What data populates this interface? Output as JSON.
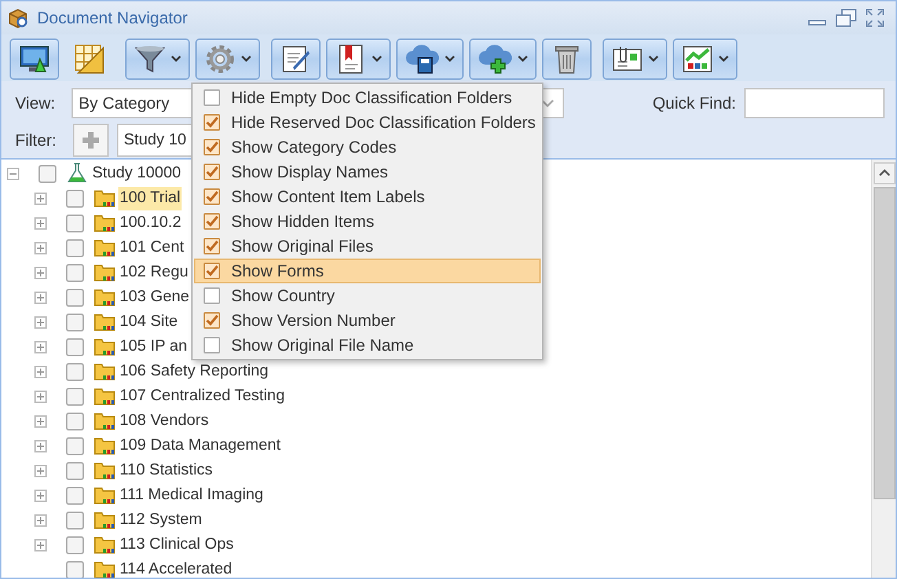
{
  "window": {
    "title": "Document Navigator"
  },
  "toolbar": {
    "groups": [
      {
        "buttons": [
          {
            "dropdown": false,
            "framed": true
          },
          {
            "dropdown": false,
            "framed": false
          }
        ]
      },
      {
        "buttons": [
          {
            "dropdown": true,
            "framed": true
          },
          {
            "dropdown": true,
            "framed": true
          }
        ]
      },
      {
        "buttons": [
          {
            "dropdown": false,
            "framed": true
          },
          {
            "dropdown": true,
            "framed": true
          },
          {
            "dropdown": true,
            "framed": true
          },
          {
            "dropdown": true,
            "framed": true
          },
          {
            "dropdown": false,
            "framed": true
          }
        ]
      },
      {
        "buttons": [
          {
            "dropdown": true,
            "framed": true
          },
          {
            "dropdown": true,
            "framed": true
          }
        ]
      }
    ]
  },
  "view": {
    "label": "View:",
    "value": "By Category"
  },
  "quick_find": {
    "label": "Quick Find:"
  },
  "filter": {
    "label": "Filter:",
    "value": "Study 10"
  },
  "menu": {
    "items": [
      {
        "label": "Hide Empty Doc Classification Folders",
        "checked": false,
        "selected": false
      },
      {
        "label": "Hide Reserved Doc Classification Folders",
        "checked": true,
        "selected": false
      },
      {
        "label": "Show Category Codes",
        "checked": true,
        "selected": false
      },
      {
        "label": "Show Display Names",
        "checked": true,
        "selected": false
      },
      {
        "label": "Show Content Item Labels",
        "checked": true,
        "selected": false
      },
      {
        "label": "Show Hidden Items",
        "checked": true,
        "selected": false
      },
      {
        "label": "Show Original Files",
        "checked": true,
        "selected": false
      },
      {
        "label": "Show Forms",
        "checked": true,
        "selected": true
      },
      {
        "label": "Show Country",
        "checked": false,
        "selected": false
      },
      {
        "label": "Show Version Number",
        "checked": true,
        "selected": false
      },
      {
        "label": "Show Original File Name",
        "checked": false,
        "selected": false
      }
    ]
  },
  "tree": [
    {
      "label": "Study 10000",
      "kind": "study",
      "expanded": true,
      "checked": false,
      "selected": false,
      "children": [
        {
          "label": "100 Trial",
          "kind": "folder",
          "expanded": false,
          "checked": false,
          "selected": true
        },
        {
          "label": "100.10.2",
          "kind": "folder",
          "expanded": false,
          "checked": false,
          "selected": false
        },
        {
          "label": "101 Cent",
          "kind": "folder",
          "expanded": false,
          "checked": false,
          "selected": false
        },
        {
          "label": "102 Regu",
          "kind": "folder",
          "expanded": false,
          "checked": false,
          "selected": false
        },
        {
          "label": "103 Gene",
          "kind": "folder",
          "expanded": false,
          "checked": false,
          "selected": false
        },
        {
          "label": "104 Site",
          "kind": "folder",
          "expanded": false,
          "checked": false,
          "selected": false
        },
        {
          "label": "105 IP an",
          "kind": "folder",
          "expanded": false,
          "checked": false,
          "selected": false
        },
        {
          "label": "106 Safety Reporting",
          "kind": "folder",
          "expanded": false,
          "checked": false,
          "selected": false
        },
        {
          "label": "107 Centralized Testing",
          "kind": "folder",
          "expanded": false,
          "checked": false,
          "selected": false
        },
        {
          "label": "108 Vendors",
          "kind": "folder",
          "expanded": false,
          "checked": false,
          "selected": false
        },
        {
          "label": "109 Data Management",
          "kind": "folder",
          "expanded": false,
          "checked": false,
          "selected": false
        },
        {
          "label": "110 Statistics",
          "kind": "folder",
          "expanded": false,
          "checked": false,
          "selected": false
        },
        {
          "label": "111 Medical Imaging",
          "kind": "folder",
          "expanded": false,
          "checked": false,
          "selected": false
        },
        {
          "label": "112 System",
          "kind": "folder",
          "expanded": false,
          "checked": false,
          "selected": false
        },
        {
          "label": "113 Clinical Ops",
          "kind": "folder",
          "expanded": false,
          "checked": false,
          "selected": false
        },
        {
          "label": "114 Accelerated",
          "kind": "folder",
          "checked": false,
          "selected": false
        }
      ]
    }
  ]
}
